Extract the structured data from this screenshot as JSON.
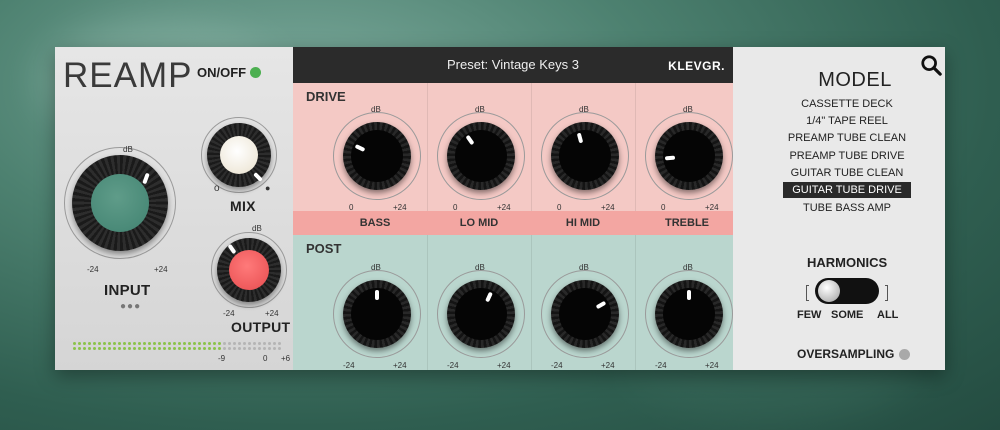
{
  "plugin": {
    "logo": "REAMP",
    "power_label": "ON/OFF",
    "power_led_color": "#4caf50",
    "accent_input": "#4a8a78",
    "accent_output": "#ee5a5c",
    "mix_color": "#f0eadc"
  },
  "left": {
    "input": {
      "label": "INPUT",
      "db": "dB",
      "min": "-24",
      "max": "+24"
    },
    "mix": {
      "label": "MIX",
      "min_marker": "o",
      "max_marker": "●"
    },
    "output": {
      "label": "OUTPUT",
      "db": "dB",
      "min": "-24",
      "max": "+24"
    },
    "meter_scale": {
      "a": "-9",
      "b": "0",
      "c": "+6"
    }
  },
  "header": {
    "preset": "Preset: Vintage Keys 3",
    "brand": "KLEVGR."
  },
  "drive": {
    "label": "DRIVE",
    "knobs": [
      {
        "db": "dB",
        "min": "0",
        "max": "+24"
      },
      {
        "db": "dB",
        "min": "0",
        "max": "+24"
      },
      {
        "db": "dB",
        "min": "0",
        "max": "+24"
      },
      {
        "db": "dB",
        "min": "0",
        "max": "+24"
      }
    ]
  },
  "bands": [
    "BASS",
    "LO MID",
    "HI MID",
    "TREBLE"
  ],
  "post": {
    "label": "POST",
    "knobs": [
      {
        "db": "dB",
        "min": "-24",
        "max": "+24"
      },
      {
        "db": "dB",
        "min": "-24",
        "max": "+24"
      },
      {
        "db": "dB",
        "min": "-24",
        "max": "+24"
      },
      {
        "db": "dB",
        "min": "-24",
        "max": "+24"
      }
    ]
  },
  "model": {
    "title": "MODEL",
    "items": [
      "CASSETTE DECK",
      "1/4\" TAPE REEL",
      "PREAMP TUBE CLEAN",
      "PREAMP TUBE DRIVE",
      "GUITAR TUBE CLEAN",
      "GUITAR TUBE DRIVE",
      "TUBE BASS AMP"
    ],
    "selected": "GUITAR TUBE DRIVE"
  },
  "harmonics": {
    "label": "HARMONICS",
    "few": "FEW",
    "some": "SOME",
    "all": "ALL"
  },
  "oversampling": {
    "label": "OVERSAMPLING"
  },
  "icons": {
    "search": "search-icon"
  }
}
